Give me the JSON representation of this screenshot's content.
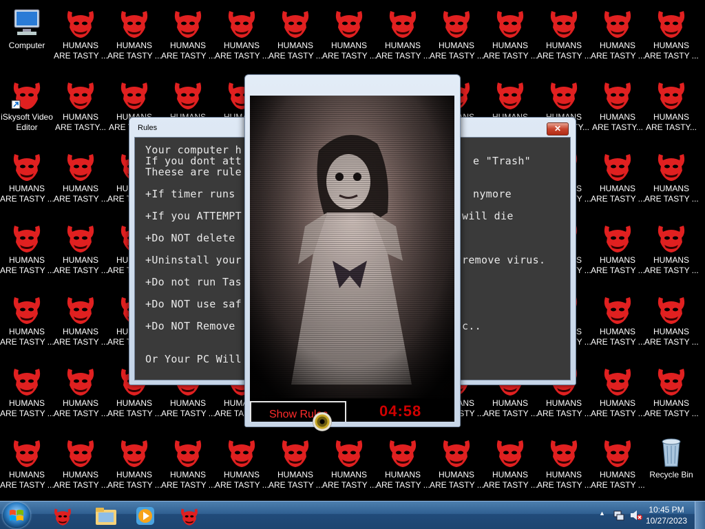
{
  "desktop": {
    "computer_label": "Computer",
    "isky_label_1": "iSkysoft Video",
    "isky_label_2": "Editor",
    "recycle_label": "Recycle Bin",
    "humans_line1": "HUMANS",
    "humans_line2": "ARE TASTY ...",
    "humans_line2_alt": "ARE TASTY...",
    "humans_line2_short": "ARE TA",
    "humans_line2_tiny": "ARE T",
    "humans_line2_tiny2": "ARE",
    "humans_line2_a": "A",
    "humans_line1_hu": "HU",
    "humans_line1_huma": "HUMA",
    "humans_line1_is": "IS",
    "humans_line1_ans": "ANS",
    "humans_line2_sty": "STY ...",
    "humans_line2_tasty": "TASTY ..."
  },
  "rules_window": {
    "title": "Rules",
    "close_glyph": "✕",
    "lines_left": [
      "Your computer h",
      "If you dont att",
      "Theese are rule",
      "+If timer runs",
      "+If you ATTEMPT",
      "+Do NOT delete",
      "+Uninstall your",
      "+Do not run Tas",
      "+Do NOT use saf",
      "+Do NOT Remove",
      "Or Your PC Will"
    ],
    "lines_right": [
      "e \"Trash\"",
      "nymore",
      "will die",
      "remove virus.",
      "c.."
    ]
  },
  "horror_window": {
    "show_rules_label": "Show Rules",
    "timer": "04:58"
  },
  "taskbar": {
    "time": "10:45 PM",
    "date": "10/27/2023",
    "tray_chevron": "▲"
  },
  "colors": {
    "demon_red": "#e02020",
    "timer_red": "#d00000"
  },
  "icons": [
    "computer-icon",
    "iskysoft-icon",
    "demon-icon",
    "recycle-bin-icon",
    "windows-logo-icon",
    "explorer-icon",
    "media-player-icon"
  ]
}
